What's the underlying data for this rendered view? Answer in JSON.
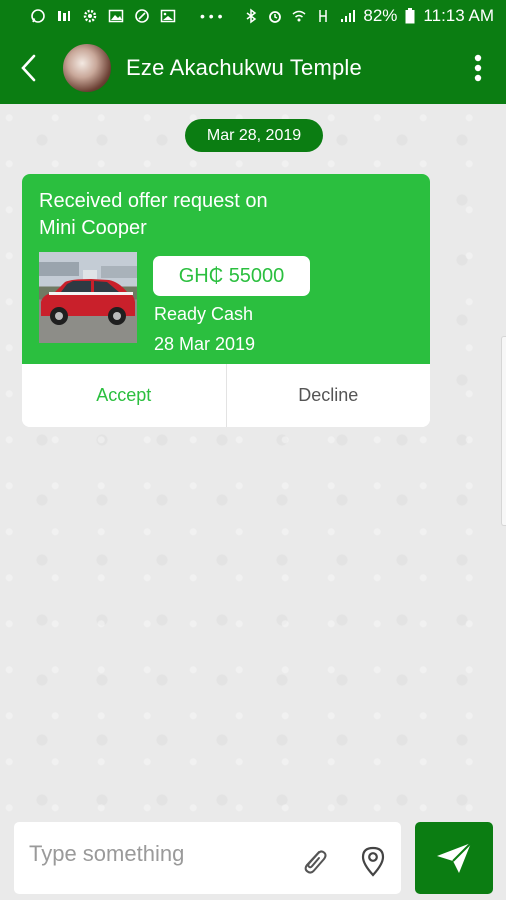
{
  "status_bar": {
    "battery": "82%",
    "time": "11:13 AM",
    "icons": [
      "whatsapp-icon",
      "app-icon",
      "settings-icon",
      "image-icon",
      "browser-icon",
      "gallery-icon",
      "more-dots-icon",
      "bluetooth-icon",
      "alarm-icon",
      "wifi-icon",
      "data-icon",
      "signal-icon",
      "battery-icon"
    ]
  },
  "header": {
    "contact_name": "Eze Akachukwu Temple",
    "icons": [
      "back-arrow-icon",
      "more-vert-icon"
    ]
  },
  "chat": {
    "date_label": "Mar 28, 2019",
    "offer": {
      "title_line1": "Received offer request on",
      "title_line2": "Mini Cooper",
      "price": "GH₵ 55000",
      "payment_type": "Ready Cash",
      "date": "28 Mar 2019",
      "accept_label": "Accept",
      "decline_label": "Decline"
    }
  },
  "composer": {
    "placeholder": "Type something",
    "value": "",
    "icons": [
      "paperclip-icon",
      "location-pin-icon",
      "send-icon"
    ]
  },
  "colors": {
    "primary": "#0b7d12",
    "accent": "#2bbf3f",
    "background": "#ececec"
  }
}
